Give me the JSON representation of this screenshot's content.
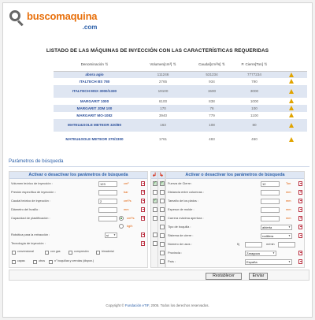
{
  "brand": {
    "name": "buscomaquina",
    "tld": ".com"
  },
  "page_title": "LISTADO DE LAS MÁQUINAS DE INYECCIÓN CON LAS CARACTERÍSTICAS REQUERIDAS",
  "results": {
    "headers": [
      "Denominación",
      "Volumen[cm³]",
      "Caudal[cm³/s]",
      "P. Cierre[Ton]"
    ],
    "rows": [
      {
        "name": "abora agio",
        "v": "111246",
        "c": "531234",
        "p": "7777234"
      },
      {
        "name": "ITALTECH BS 780",
        "v": "2765",
        "c": "934",
        "p": "790"
      },
      {
        "name": "ITALTECH MSX 3000/1330",
        "v": "19100",
        "c": "1500",
        "p": "3000"
      },
      {
        "name": "MARGARIT 1000",
        "v": "6100",
        "c": "838",
        "p": "1000"
      },
      {
        "name": "MARGARIT JDM 100",
        "v": "170",
        "c": "76",
        "p": "100"
      },
      {
        "name": "MARGARIT MO-1082",
        "v": "3940",
        "c": "779",
        "p": "1100"
      },
      {
        "name": "MATEU&SOLE METEOR 320/80",
        "v": "163",
        "c": "108",
        "p": "80"
      },
      {
        "name": "MATEU&SOLE METEOR 370/2300",
        "v": "1761",
        "c": "483",
        "p": "460"
      }
    ]
  },
  "params": {
    "section_title": "Parámetros de búsqueda",
    "left_header": "Activar o desactivar los parámetros de búsqueda",
    "right_header": "Activar o desactivar los parámetros de búsqueda",
    "left": {
      "vol_label": "Volumen teórico de inyección :",
      "vol_value": "123",
      "vol_unit": "cm³",
      "pres_label": "Presión específica de inyección :",
      "pres_unit": "bar",
      "caudal_label": "Caudal teórico de inyección :",
      "caudal_value": "2",
      "caudal_unit": "cm³/s",
      "husillo_label": "Diámetro del husillo :",
      "husillo_unit": "mm",
      "plast_label": "Capacidad de plastificación :",
      "plast_unit1": "cm³/s",
      "plast_unit2": "kg/h",
      "robot_label": "Robótica para la extracción :",
      "robot_value": "sí",
      "tech_label": "Tecnología de inyección :",
      "tech_options": [
        "convencional",
        "con gas",
        "compresión",
        "bimaterial",
        "capas",
        "otros",
        "n° boquillas y cerrolas (dispon.)"
      ]
    },
    "right": {
      "cierre_label": "Fuerza de Cierre :",
      "cierre_value": "12",
      "cierre_unit": "Ton",
      "columnas_label": "Distancia entre columnas :",
      "columnas_unit": "mm",
      "platos_label": "Tamaño de los platos :",
      "platos_unit": "mm",
      "molde_label": "Espesor de molde :",
      "molde_unit": "mm",
      "apertura_label": "Carrera máxima apertura :",
      "apertura_unit": "mm",
      "boquilla_label": "Tipo de boquilla :",
      "boquilla_value": "abierta",
      "sistema_label": "Sistema de cierre :",
      "sistema_value": "rodillera",
      "usos_label": "Número de usos :",
      "usos_desde": "fij",
      "usos_hasta": "m/min",
      "provincia_label": "Provincia :",
      "provincia_value": "Zaragoza",
      "pais_label": "País :",
      "pais_value": "España"
    },
    "reset_label": "Restablecer",
    "submit_label": "Enviar"
  },
  "footer": {
    "prefix": "Copyright ©",
    "link": "Fundación eTIF",
    "suffix": ", 2005. Todos los derechos reservados."
  }
}
